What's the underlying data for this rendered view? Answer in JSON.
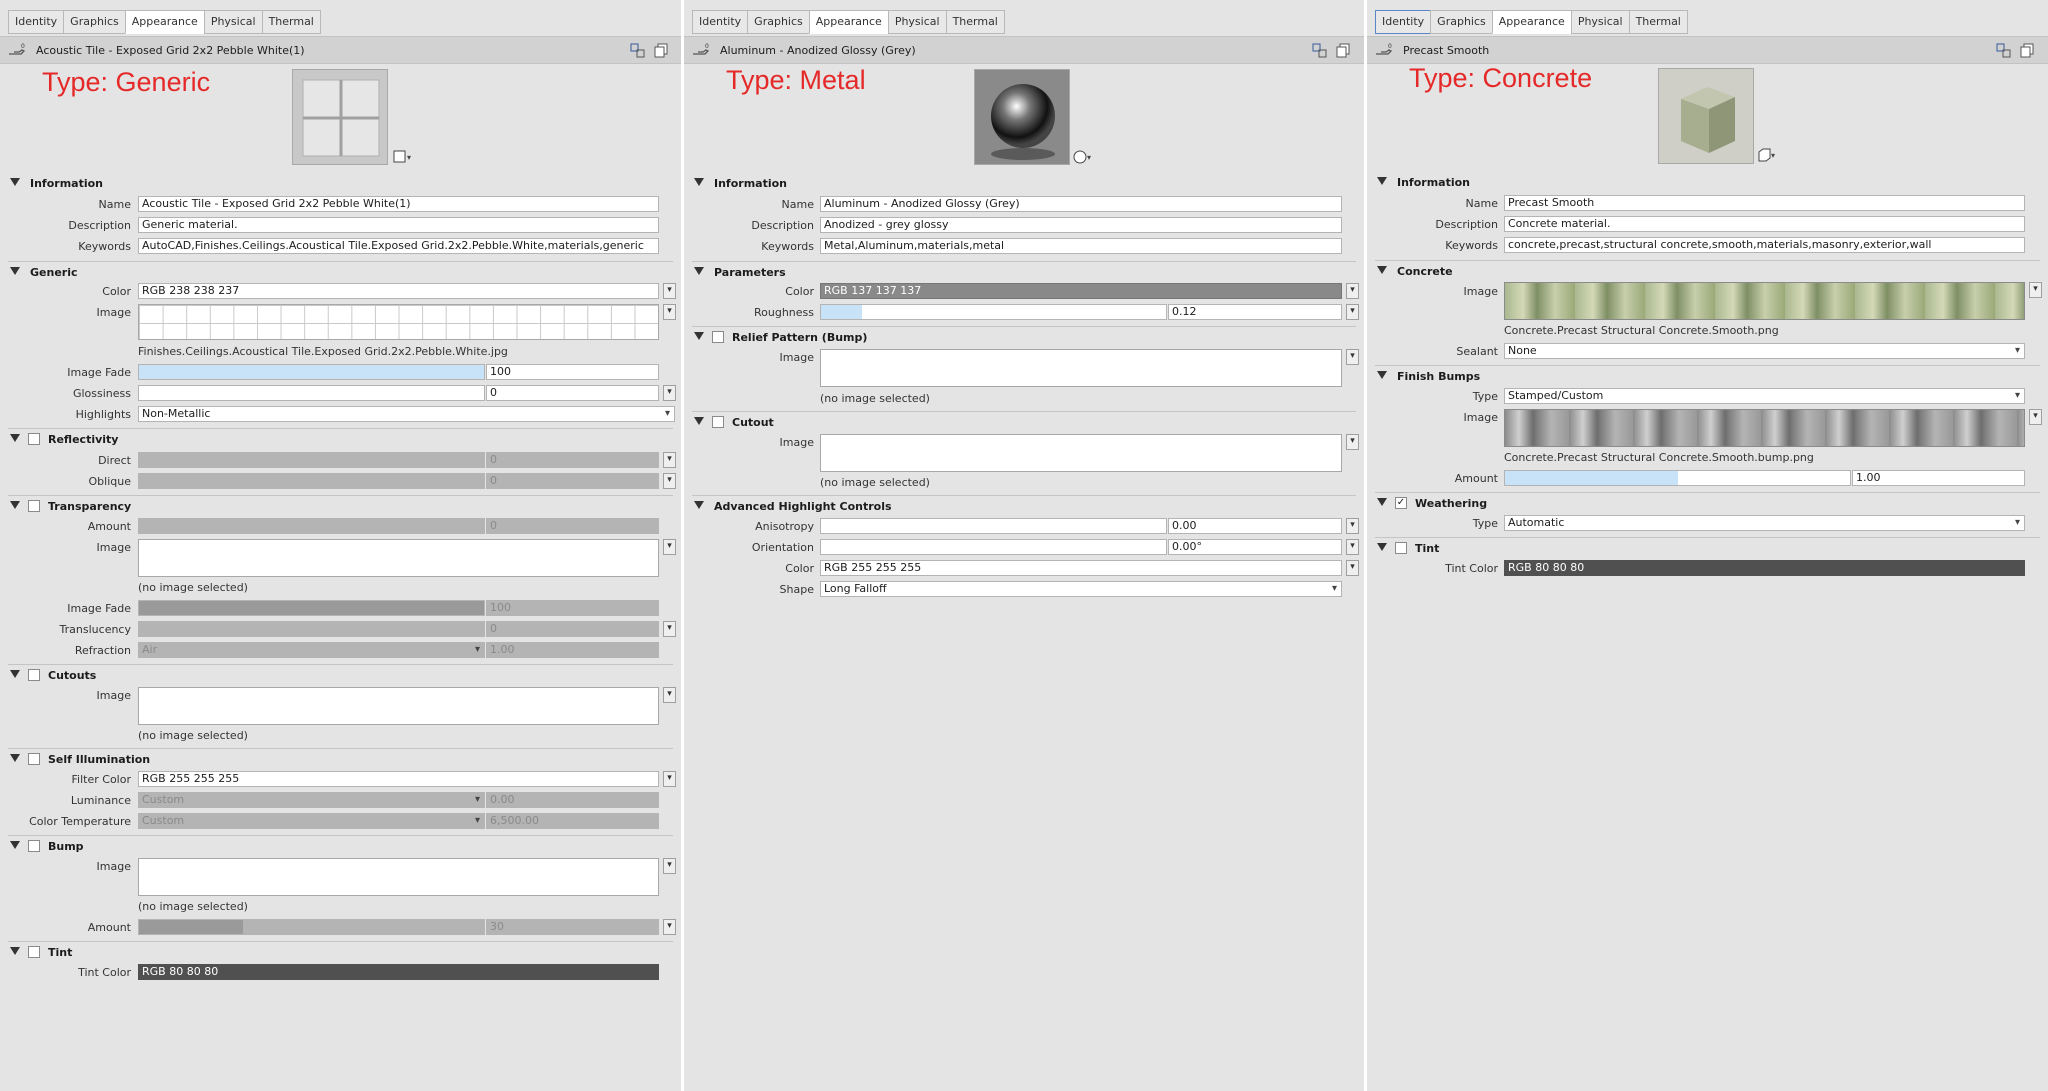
{
  "panels": [
    {
      "tabs": [
        "Identity",
        "Graphics",
        "Appearance",
        "Physical",
        "Thermal"
      ],
      "title": "Acoustic Tile - Exposed Grid 2x2 Pebble White(1)",
      "type_label": "Type: Generic",
      "sections": {
        "information": {
          "title": "Information",
          "name_label": "Name",
          "name": "Acoustic Tile - Exposed Grid 2x2 Pebble White(1)",
          "description_label": "Description",
          "description": "Generic material.",
          "keywords_label": "Keywords",
          "keywords": "AutoCAD,Finishes.Ceilings.Acoustical Tile.Exposed Grid.2x2.Pebble.White,materials,generic"
        },
        "generic": {
          "title": "Generic",
          "color_label": "Color",
          "color": "RGB 238 238 237",
          "image_label": "Image",
          "image_file": "Finishes.Ceilings.Acoustical Tile.Exposed Grid.2x2.Pebble.White.jpg",
          "image_fade_label": "Image Fade",
          "image_fade": "100",
          "glossiness_label": "Glossiness",
          "glossiness": "0",
          "highlights_label": "Highlights",
          "highlights": "Non-Metallic"
        },
        "reflectivity": {
          "title": "Reflectivity",
          "direct_label": "Direct",
          "direct": "0",
          "oblique_label": "Oblique",
          "oblique": "0"
        },
        "transparency": {
          "title": "Transparency",
          "amount_label": "Amount",
          "amount": "0",
          "image_label": "Image",
          "image_note": "(no image selected)",
          "image_fade_label": "Image Fade",
          "image_fade": "100",
          "translucency_label": "Translucency",
          "translucency": "0",
          "refraction_label": "Refraction",
          "refraction_preset": "Air",
          "refraction": "1.00"
        },
        "cutouts": {
          "title": "Cutouts",
          "image_label": "Image",
          "image_note": "(no image selected)"
        },
        "self_illumination": {
          "title": "Self Illumination",
          "filter_color_label": "Filter Color",
          "filter_color": "RGB 255 255 255",
          "luminance_label": "Luminance",
          "luminance_preset": "Custom",
          "luminance": "0.00",
          "color_temp_label": "Color Temperature",
          "color_temp_preset": "Custom",
          "color_temp": "6,500.00"
        },
        "bump": {
          "title": "Bump",
          "image_label": "Image",
          "image_note": "(no image selected)",
          "amount_label": "Amount",
          "amount": "30"
        },
        "tint": {
          "title": "Tint",
          "tint_color_label": "Tint Color",
          "tint_color": "RGB 80 80 80"
        }
      }
    },
    {
      "tabs": [
        "Identity",
        "Graphics",
        "Appearance",
        "Physical",
        "Thermal"
      ],
      "title": "Aluminum - Anodized Glossy (Grey)",
      "type_label": "Type: Metal",
      "sections": {
        "information": {
          "title": "Information",
          "name_label": "Name",
          "name": "Aluminum - Anodized Glossy (Grey)",
          "description_label": "Description",
          "description": "Anodized - grey glossy",
          "keywords_label": "Keywords",
          "keywords": "Metal,Aluminum,materials,metal"
        },
        "parameters": {
          "title": "Parameters",
          "color_label": "Color",
          "color": "RGB 137 137 137",
          "roughness_label": "Roughness",
          "roughness": "0.12"
        },
        "relief": {
          "title": "Relief Pattern (Bump)",
          "image_label": "Image",
          "image_note": "(no image selected)"
        },
        "cutout": {
          "title": "Cutout",
          "image_label": "Image",
          "image_note": "(no image selected)"
        },
        "advanced": {
          "title": "Advanced Highlight Controls",
          "anisotropy_label": "Anisotropy",
          "anisotropy": "0.00",
          "orientation_label": "Orientation",
          "orientation": "0.00°",
          "color_label": "Color",
          "color": "RGB 255 255 255",
          "shape_label": "Shape",
          "shape": "Long Falloff"
        }
      }
    },
    {
      "tabs": [
        "Identity",
        "Graphics",
        "Appearance",
        "Physical",
        "Thermal"
      ],
      "title": "Precast Smooth",
      "type_label": "Type: Concrete",
      "sections": {
        "information": {
          "title": "Information",
          "name_label": "Name",
          "name": "Precast Smooth",
          "description_label": "Description",
          "description": "Concrete material.",
          "keywords_label": "Keywords",
          "keywords": "concrete,precast,structural concrete,smooth,materials,masonry,exterior,wall"
        },
        "concrete": {
          "title": "Concrete",
          "image_label": "Image",
          "image_file": "Concrete.Precast Structural Concrete.Smooth.png",
          "sealant_label": "Sealant",
          "sealant": "None"
        },
        "finish_bumps": {
          "title": "Finish Bumps",
          "type_label": "Type",
          "type": "Stamped/Custom",
          "image_label": "Image",
          "image_file": "Concrete.Precast Structural Concrete.Smooth.bump.png",
          "amount_label": "Amount",
          "amount": "1.00"
        },
        "weathering": {
          "title": "Weathering",
          "type_label": "Type",
          "type": "Automatic"
        },
        "tint": {
          "title": "Tint",
          "tint_color_label": "Tint Color",
          "tint_color": "RGB 80 80 80"
        }
      }
    }
  ],
  "values": {
    "generic_image_fade": 1.0,
    "bump_amount": 0.3,
    "roughness": 0.12,
    "concrete_bump_amount": 0.5
  },
  "colors": {
    "generic_color": "#eeeeed",
    "metal_color": "#898989",
    "tint_color": "#505050",
    "accent_red": "#e52929"
  }
}
